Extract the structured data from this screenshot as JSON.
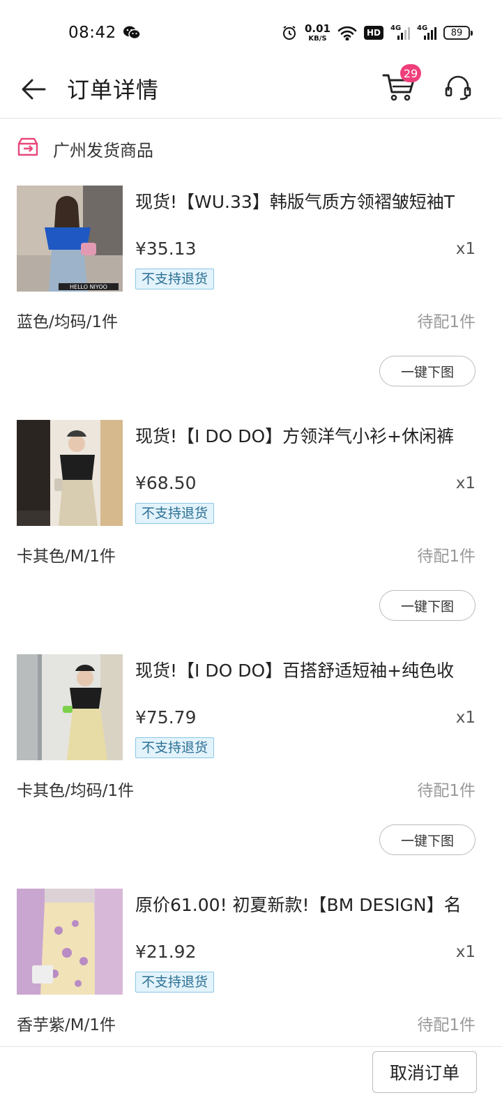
{
  "status_bar": {
    "time": "08:42",
    "net_speed_value": "0.01",
    "net_speed_unit": "KB/S",
    "hd_label": "HD",
    "signal_1_label": "4G",
    "signal_2_label": "4G",
    "battery": "89",
    "icons": [
      "wechat-icon",
      "alarm-icon",
      "wifi-icon",
      "signal-icon",
      "battery-icon"
    ]
  },
  "header": {
    "title": "订单详情",
    "cart_count": "29",
    "icons": [
      "back-arrow-icon",
      "cart-icon",
      "headset-icon"
    ]
  },
  "section": {
    "title": "广州发货商品",
    "icon": "store-box-icon"
  },
  "items": [
    {
      "title": "现货!【WU.33】韩版气质方领褶皱短袖T",
      "price": "¥35.13",
      "qty": "x1",
      "tag": "不支持退货",
      "spec": "蓝色/均码/1件",
      "status": "待配1件",
      "action": "一键下图",
      "image_watermark": "HELLO NIYOO",
      "accent": "#1f57c3"
    },
    {
      "title": "现货!【I DO DO】方领洋气小衫+休闲裤",
      "price": "¥68.50",
      "qty": "x1",
      "tag": "不支持退货",
      "spec": "卡其色/M/1件",
      "status": "待配1件",
      "action": "一键下图",
      "accent": "#d8cdb0"
    },
    {
      "title": "现货!【I DO DO】百搭舒适短袖+纯色收",
      "price": "¥75.79",
      "qty": "x1",
      "tag": "不支持退货",
      "spec": "卡其色/均码/1件",
      "status": "待配1件",
      "action": "一键下图",
      "accent": "#e8dca6"
    },
    {
      "title": "原价61.00! 初夏新款!【BM DESIGN】名",
      "price": "¥21.92",
      "qty": "x1",
      "tag": "不支持退货",
      "spec": "香芋紫/M/1件",
      "status": "待配1件",
      "action": "一键下图",
      "accent": "#c9a6cf"
    }
  ],
  "bottom": {
    "cancel_label": "取消订单"
  },
  "colors": {
    "badge": "#ef3f7a",
    "tag_bg": "#e3f3fb",
    "tag_border": "#8ac6e6",
    "tag_text": "#2a6f94",
    "store_icon": "#e8487a"
  }
}
